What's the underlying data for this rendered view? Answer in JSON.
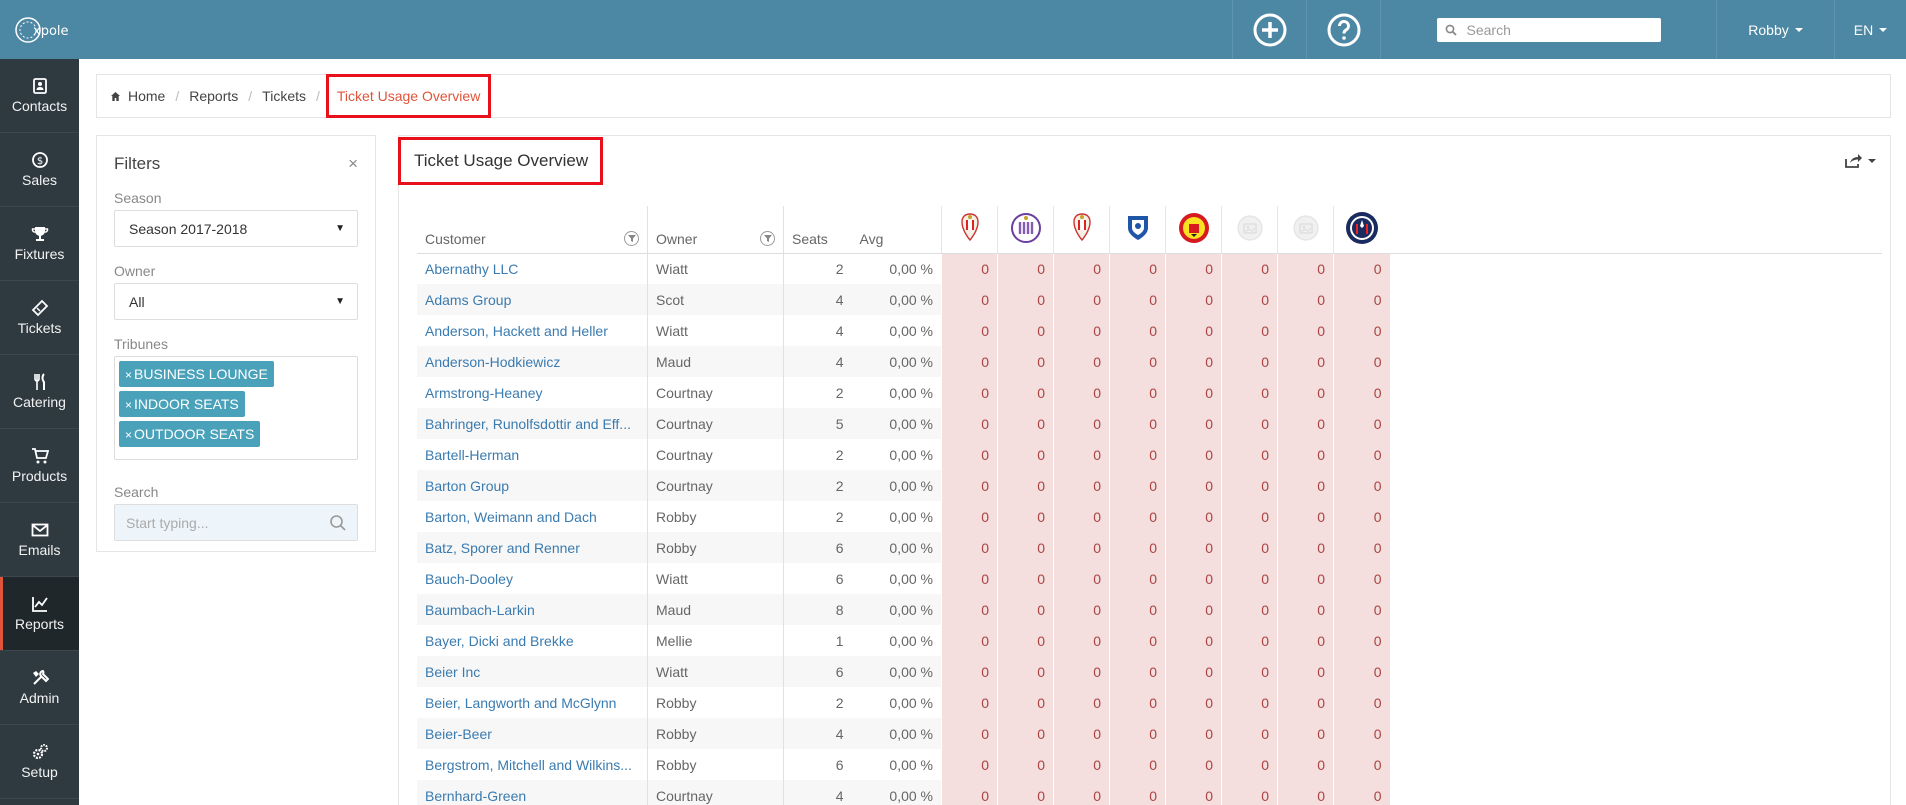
{
  "app": {
    "logo_text": "xpole"
  },
  "sidebar": {
    "items": [
      {
        "label": "Contacts",
        "icon": "contacts-icon"
      },
      {
        "label": "Sales",
        "icon": "coin-icon"
      },
      {
        "label": "Fixtures",
        "icon": "trophy-icon"
      },
      {
        "label": "Tickets",
        "icon": "ticket-icon"
      },
      {
        "label": "Catering",
        "icon": "cutlery-icon"
      },
      {
        "label": "Products",
        "icon": "cart-icon"
      },
      {
        "label": "Emails",
        "icon": "envelope-icon"
      },
      {
        "label": "Reports",
        "icon": "chart-icon",
        "active": true
      },
      {
        "label": "Admin",
        "icon": "tools-icon"
      },
      {
        "label": "Setup",
        "icon": "gears-icon"
      }
    ]
  },
  "topbar": {
    "search_placeholder": "Search",
    "user": "Robby",
    "lang": "EN"
  },
  "breadcrumb": {
    "home": "Home",
    "reports": "Reports",
    "tickets": "Tickets",
    "current": "Ticket Usage Overview",
    "separator": "/"
  },
  "filters": {
    "title": "Filters",
    "close": "×",
    "season_label": "Season",
    "season_value": "Season 2017-2018",
    "owner_label": "Owner",
    "owner_value": "All",
    "tribunes_label": "Tribunes",
    "tribunes": [
      "BUSINESS LOUNGE",
      "INDOOR SEATS",
      "OUTDOOR SEATS"
    ],
    "search_label": "Search",
    "search_placeholder": "Start typing..."
  },
  "report": {
    "title": "Ticket Usage Overview",
    "columns": {
      "customer": "Customer",
      "owner": "Owner",
      "seats": "Seats",
      "avg": "Avg"
    },
    "clubs": [
      "standard-liege-crest-icon",
      "anderlecht-crest-icon",
      "standard-liege-crest-icon",
      "genk-crest-icon",
      "manchester-united-crest-icon",
      "placeholder-crest-icon",
      "placeholder-crest-icon",
      "psg-crest-icon"
    ],
    "rows": [
      {
        "customer": "Abernathy LLC",
        "owner": "Wiatt",
        "seats": "2",
        "avg": "0,00 %",
        "values": [
          "0",
          "0",
          "0",
          "0",
          "0",
          "0",
          "0",
          "0"
        ]
      },
      {
        "customer": "Adams Group",
        "owner": "Scot",
        "seats": "4",
        "avg": "0,00 %",
        "values": [
          "0",
          "0",
          "0",
          "0",
          "0",
          "0",
          "0",
          "0"
        ]
      },
      {
        "customer": "Anderson, Hackett and Heller",
        "owner": "Wiatt",
        "seats": "4",
        "avg": "0,00 %",
        "values": [
          "0",
          "0",
          "0",
          "0",
          "0",
          "0",
          "0",
          "0"
        ]
      },
      {
        "customer": "Anderson-Hodkiewicz",
        "owner": "Maud",
        "seats": "4",
        "avg": "0,00 %",
        "values": [
          "0",
          "0",
          "0",
          "0",
          "0",
          "0",
          "0",
          "0"
        ]
      },
      {
        "customer": "Armstrong-Heaney",
        "owner": "Courtnay",
        "seats": "2",
        "avg": "0,00 %",
        "values": [
          "0",
          "0",
          "0",
          "0",
          "0",
          "0",
          "0",
          "0"
        ]
      },
      {
        "customer": "Bahringer, Runolfsdottir and Eff...",
        "owner": "Courtnay",
        "seats": "5",
        "avg": "0,00 %",
        "values": [
          "0",
          "0",
          "0",
          "0",
          "0",
          "0",
          "0",
          "0"
        ]
      },
      {
        "customer": "Bartell-Herman",
        "owner": "Courtnay",
        "seats": "2",
        "avg": "0,00 %",
        "values": [
          "0",
          "0",
          "0",
          "0",
          "0",
          "0",
          "0",
          "0"
        ]
      },
      {
        "customer": "Barton Group",
        "owner": "Courtnay",
        "seats": "2",
        "avg": "0,00 %",
        "values": [
          "0",
          "0",
          "0",
          "0",
          "0",
          "0",
          "0",
          "0"
        ]
      },
      {
        "customer": "Barton, Weimann and Dach",
        "owner": "Robby",
        "seats": "2",
        "avg": "0,00 %",
        "values": [
          "0",
          "0",
          "0",
          "0",
          "0",
          "0",
          "0",
          "0"
        ]
      },
      {
        "customer": "Batz, Sporer and Renner",
        "owner": "Robby",
        "seats": "6",
        "avg": "0,00 %",
        "values": [
          "0",
          "0",
          "0",
          "0",
          "0",
          "0",
          "0",
          "0"
        ]
      },
      {
        "customer": "Bauch-Dooley",
        "owner": "Wiatt",
        "seats": "6",
        "avg": "0,00 %",
        "values": [
          "0",
          "0",
          "0",
          "0",
          "0",
          "0",
          "0",
          "0"
        ]
      },
      {
        "customer": "Baumbach-Larkin",
        "owner": "Maud",
        "seats": "8",
        "avg": "0,00 %",
        "values": [
          "0",
          "0",
          "0",
          "0",
          "0",
          "0",
          "0",
          "0"
        ]
      },
      {
        "customer": "Bayer, Dicki and Brekke",
        "owner": "Mellie",
        "seats": "1",
        "avg": "0,00 %",
        "values": [
          "0",
          "0",
          "0",
          "0",
          "0",
          "0",
          "0",
          "0"
        ]
      },
      {
        "customer": "Beier Inc",
        "owner": "Wiatt",
        "seats": "6",
        "avg": "0,00 %",
        "values": [
          "0",
          "0",
          "0",
          "0",
          "0",
          "0",
          "0",
          "0"
        ]
      },
      {
        "customer": "Beier, Langworth and McGlynn",
        "owner": "Robby",
        "seats": "2",
        "avg": "0,00 %",
        "values": [
          "0",
          "0",
          "0",
          "0",
          "0",
          "0",
          "0",
          "0"
        ]
      },
      {
        "customer": "Beier-Beer",
        "owner": "Robby",
        "seats": "4",
        "avg": "0,00 %",
        "values": [
          "0",
          "0",
          "0",
          "0",
          "0",
          "0",
          "0",
          "0"
        ]
      },
      {
        "customer": "Bergstrom, Mitchell and Wilkins...",
        "owner": "Robby",
        "seats": "6",
        "avg": "0,00 %",
        "values": [
          "0",
          "0",
          "0",
          "0",
          "0",
          "0",
          "0",
          "0"
        ]
      },
      {
        "customer": "Bernhard-Green",
        "owner": "Courtnay",
        "seats": "4",
        "avg": "0,00 %",
        "values": [
          "0",
          "0",
          "0",
          "0",
          "0",
          "0",
          "0",
          "0"
        ]
      }
    ]
  }
}
